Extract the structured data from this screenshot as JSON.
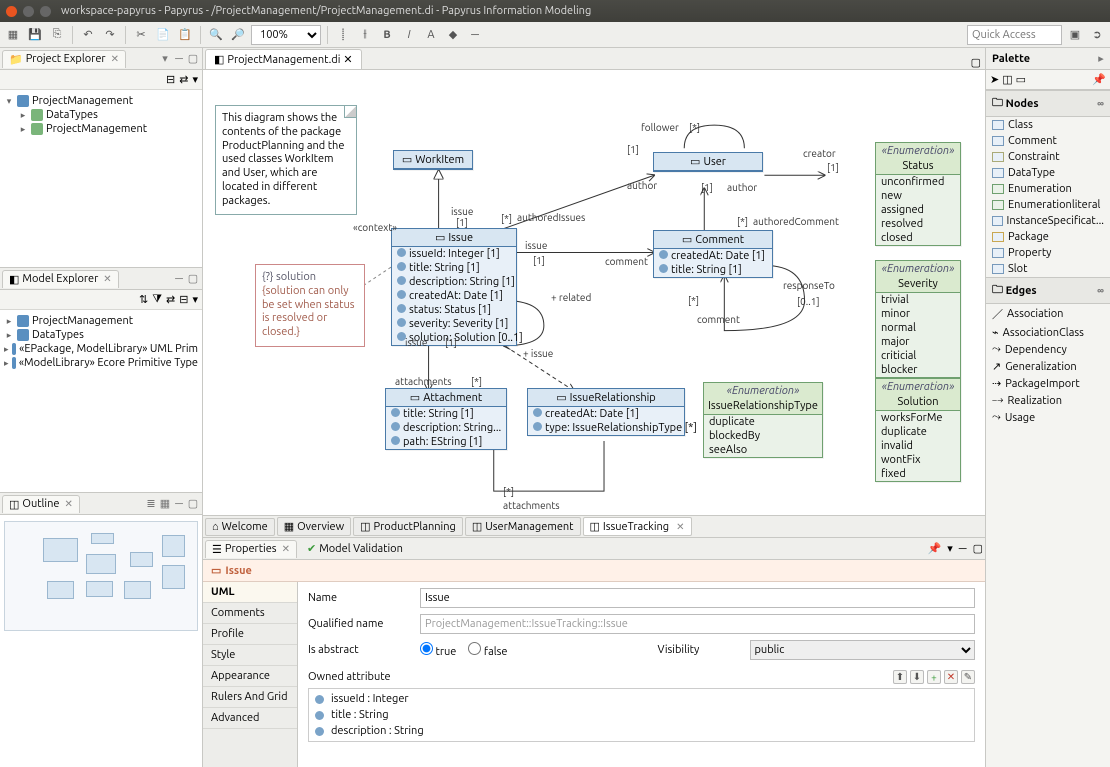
{
  "window": {
    "title": "workspace-papyrus - Papyrus - /ProjectManagement/ProjectManagement.di - Papyrus Information Modeling"
  },
  "toolbar": {
    "zoom": "100%",
    "quick_access_placeholder": "Quick Access"
  },
  "project_explorer": {
    "title": "Project Explorer",
    "root": "ProjectManagement",
    "children": [
      "DataTypes",
      "ProjectManagement"
    ]
  },
  "model_explorer": {
    "title": "Model Explorer",
    "items": [
      "ProjectManagement",
      "DataTypes",
      "«EPackage, ModelLibrary» UML Prim",
      "«ModelLibrary» Ecore Primitive Type"
    ]
  },
  "outline": {
    "title": "Outline"
  },
  "editor": {
    "tab": "ProjectManagement.di"
  },
  "diagram": {
    "note_main": "This diagram shows the contents of the package ProductPlanning and the used classes WorkItem and User, which are located in different packages.",
    "note_solution_hdr": "{?} solution",
    "note_solution": "{solution can only be set when status is resolved or closed.}",
    "workitem": {
      "title": "WorkItem"
    },
    "user": {
      "title": "User"
    },
    "issue": {
      "title": "Issue",
      "attrs": [
        "issueId: Integer [1]",
        "title: String [1]",
        "description: String [1]",
        "createdAt: Date [1]",
        "status: Status [1]",
        "severity: Severity [1]",
        "solution: Solution [0..1]"
      ]
    },
    "comment": {
      "title": "Comment",
      "attrs": [
        "createdAt: Date [1]",
        "title: String [1]"
      ]
    },
    "attachment": {
      "title": "Attachment",
      "attrs": [
        "title: String [1]",
        "description: String...",
        "path: EString [1]"
      ]
    },
    "issuerel": {
      "title": "IssueRelationship",
      "attrs": [
        "createdAt: Date [1]",
        "type: IssueRelationshipType [*]"
      ]
    },
    "enum_reltype": {
      "stereo": "«Enumeration»",
      "title": "IssueRelationshipType",
      "lits": [
        "duplicate",
        "blockedBy",
        "seeAlso"
      ]
    },
    "enum_status": {
      "stereo": "«Enumeration»",
      "title": "Status",
      "lits": [
        "unconfirmed",
        "new",
        "assigned",
        "resolved",
        "closed"
      ]
    },
    "enum_severity": {
      "stereo": "«Enumeration»",
      "title": "Severity",
      "lits": [
        "trivial",
        "minor",
        "normal",
        "major",
        "criticial",
        "blocker"
      ]
    },
    "enum_solution": {
      "stereo": "«Enumeration»",
      "title": "Solution",
      "lits": [
        "worksForMe",
        "duplicate",
        "invalid",
        "wontFix",
        "fixed"
      ]
    },
    "labels": {
      "context": "«context»",
      "issue": "issue",
      "one": "[1]",
      "star": "[*]",
      "zeroone": "[0..1]",
      "authoredIssues": "authoredIssues",
      "author": "author",
      "follower": "follower",
      "creator": "creator",
      "authoredComment": "authoredComment",
      "comment": "comment",
      "responseTo": "responseTo",
      "plus_related": "+ related",
      "plus_issue": "+ issue",
      "attachments": "attachments"
    }
  },
  "inner_tabs": [
    "Welcome",
    "Overview",
    "ProductPlanning",
    "UserManagement",
    "IssueTracking"
  ],
  "inner_active": 4,
  "properties": {
    "tab0": "Properties",
    "tab1": "Model Validation",
    "element": "Issue",
    "side": [
      "UML",
      "Comments",
      "Profile",
      "Style",
      "Appearance",
      "Rulers And Grid",
      "Advanced"
    ],
    "name_label": "Name",
    "name_value": "Issue",
    "qname_label": "Qualified name",
    "qname_value": "ProjectManagement::IssueTracking::Issue",
    "abstract_label": "Is abstract",
    "true": "true",
    "false": "false",
    "visibility_label": "Visibility",
    "visibility_value": "public",
    "owned_label": "Owned attribute",
    "owned": [
      "issueId : Integer",
      "title : String",
      "description : String"
    ]
  },
  "palette": {
    "title": "Palette",
    "nodes_hdr": "Nodes",
    "nodes": [
      "Class",
      "Comment",
      "Constraint",
      "DataType",
      "Enumeration",
      "Enumerationliteral",
      "InstanceSpecificat...",
      "Package",
      "Property",
      "Slot"
    ],
    "edges_hdr": "Edges",
    "edges": [
      "Association",
      "AssociationClass",
      "Dependency",
      "Generalization",
      "PackageImport",
      "Realization",
      "Usage"
    ]
  }
}
